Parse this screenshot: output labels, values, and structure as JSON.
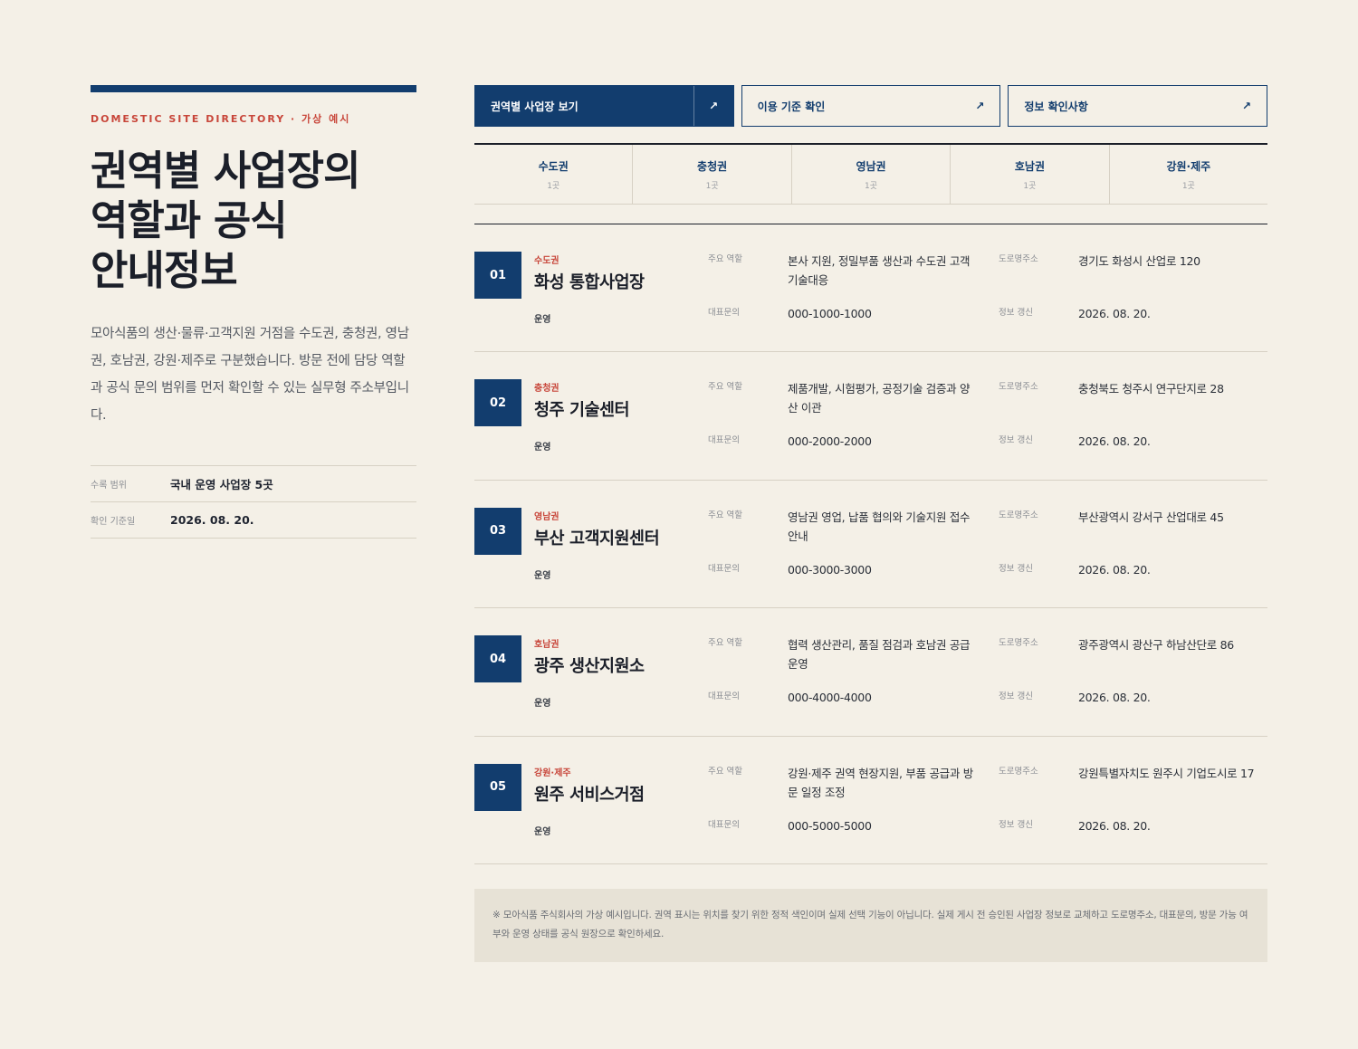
{
  "header": {
    "eyebrow": "DOMESTIC SITE DIRECTORY · 가상 예시",
    "title_lines": [
      "권역별 사업장의",
      "역할과 공식",
      "안내정보"
    ],
    "intro": "모아식품의 생산·물류·고객지원 거점을 수도권, 충청권, 영남권, 호남권, 강원·제주로 구분했습니다. 방문 전에 담당 역할과 공식 문의 범위를 먼저 확인할 수 있는 실무형 주소부입니다."
  },
  "meta": [
    {
      "key": "수록 범위",
      "value": "국내 운영 사업장 5곳"
    },
    {
      "key": "확인 기준일",
      "value": "2026. 08. 20."
    }
  ],
  "buttons": [
    {
      "label": "권역별 사업장 보기",
      "icon": "arrow-up-right-icon"
    },
    {
      "label": "이용 기준 확인",
      "icon": "arrow-up-right-icon"
    },
    {
      "label": "정보 확인사항",
      "icon": "arrow-up-right-icon"
    }
  ],
  "tabs": [
    {
      "name": "수도권",
      "count": "1곳"
    },
    {
      "name": "충청권",
      "count": "1곳"
    },
    {
      "name": "영남권",
      "count": "1곳"
    },
    {
      "name": "호남권",
      "count": "1곳"
    },
    {
      "name": "강원·제주",
      "count": "1곳"
    }
  ],
  "labels": {
    "role": "주요 역할",
    "phone": "대표문의",
    "address": "도로명주소",
    "updated": "정보 갱신"
  },
  "sites": [
    {
      "num": "01",
      "region": "수도권",
      "name": "화성 통합사업장",
      "status": "운영",
      "role": "본사 지원, 정밀부품 생산과 수도권 고객 기술대응",
      "phone": "000-1000-1000",
      "address": "경기도 화성시 산업로 120",
      "updated": "2026. 08. 20."
    },
    {
      "num": "02",
      "region": "충청권",
      "name": "청주 기술센터",
      "status": "운영",
      "role": "제품개발, 시험평가, 공정기술 검증과 양산 이관",
      "phone": "000-2000-2000",
      "address": "충청북도 청주시 연구단지로 28",
      "updated": "2026. 08. 20."
    },
    {
      "num": "03",
      "region": "영남권",
      "name": "부산 고객지원센터",
      "status": "운영",
      "role": "영남권 영업, 납품 협의와 기술지원 접수 안내",
      "phone": "000-3000-3000",
      "address": "부산광역시 강서구 산업대로 45",
      "updated": "2026. 08. 20."
    },
    {
      "num": "04",
      "region": "호남권",
      "name": "광주 생산지원소",
      "status": "운영",
      "role": "협력 생산관리, 품질 점검과 호남권 공급 운영",
      "phone": "000-4000-4000",
      "address": "광주광역시 광산구 하남산단로 86",
      "updated": "2026. 08. 20."
    },
    {
      "num": "05",
      "region": "강원·제주",
      "name": "원주 서비스거점",
      "status": "운영",
      "role": "강원·제주 권역 현장지원, 부품 공급과 방문 일정 조정",
      "phone": "000-5000-5000",
      "address": "강원특별자치도 원주시 기업도시로 17",
      "updated": "2026. 08. 20."
    }
  ],
  "note": "※ 모아식품 주식회사의 가상 예시입니다. 권역 표시는 위치를 찾기 위한 정적 색인이며 실제 선택 기능이 아닙니다. 실제 게시 전 승인된 사업장 정보로 교체하고 도로명주소, 대표문의, 방문 가능 여부와 운영 상태를 공식 원장으로 확인하세요."
}
